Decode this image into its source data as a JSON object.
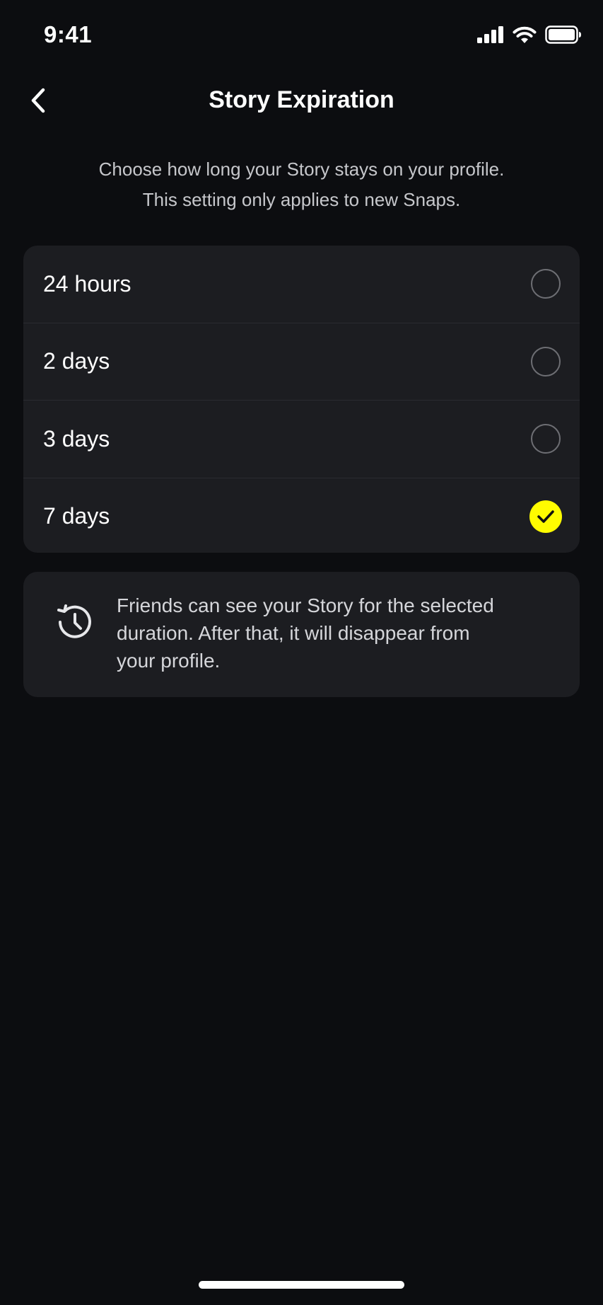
{
  "status_bar": {
    "time": "9:41",
    "icons": [
      "signal-icon",
      "wifi-icon",
      "battery-icon"
    ]
  },
  "header": {
    "back_icon": "chevron-left-icon",
    "title": "Story Expiration"
  },
  "subtitle": {
    "line1": "Choose how long your Story stays on your profile.",
    "line2": "This setting only applies to new Snaps."
  },
  "options": [
    {
      "label": "24 hours",
      "selected": false
    },
    {
      "label": "2 days",
      "selected": false
    },
    {
      "label": "3 days",
      "selected": false
    },
    {
      "label": "7 days",
      "selected": true
    }
  ],
  "info": {
    "icon": "history-icon",
    "line1": "Friends can see your Story for the selected",
    "line2": "duration. After that, it will disappear from",
    "line3": "your profile."
  },
  "colors": {
    "background": "#0c0d10",
    "card": "#1c1d21",
    "accent": "#fffc00",
    "radio_border": "#6d6e73"
  }
}
